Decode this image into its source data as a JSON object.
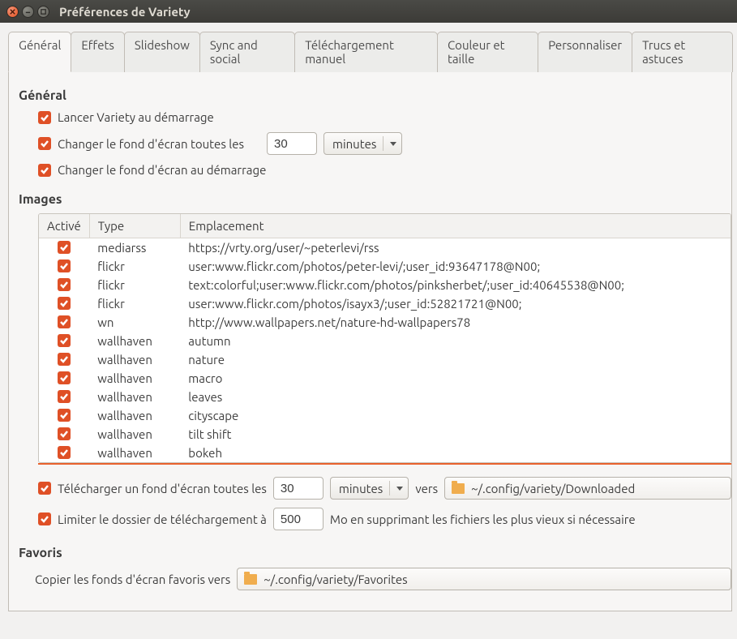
{
  "window": {
    "title": "Préférences de Variety"
  },
  "tabs": [
    {
      "label": "Général"
    },
    {
      "label": "Effets"
    },
    {
      "label": "Slideshow"
    },
    {
      "label": "Sync and social"
    },
    {
      "label": "Téléchargement manuel"
    },
    {
      "label": "Couleur et taille"
    },
    {
      "label": "Personnaliser"
    },
    {
      "label": "Trucs et astuces"
    }
  ],
  "general": {
    "heading": "Général",
    "startup_label": "Lancer Variety au démarrage",
    "change_every_label": "Changer le fond d'écran toutes les",
    "change_every_value": "30",
    "change_every_unit": "minutes",
    "change_on_start_label": "Changer le fond d'écran au démarrage"
  },
  "images": {
    "heading": "Images",
    "columns": {
      "enabled": "Activé",
      "type": "Type",
      "location": "Emplacement"
    },
    "rows": [
      {
        "enabled": true,
        "type": "mediarss",
        "location": "https://vrty.org/user/~peterlevi/rss"
      },
      {
        "enabled": true,
        "type": "flickr",
        "location": "user:www.flickr.com/photos/peter-levi/;user_id:93647178@N00;"
      },
      {
        "enabled": true,
        "type": "flickr",
        "location": "text:colorful;user:www.flickr.com/photos/pinksherbet/;user_id:40645538@N00;"
      },
      {
        "enabled": true,
        "type": "flickr",
        "location": "user:www.flickr.com/photos/isayx3/;user_id:52821721@N00;"
      },
      {
        "enabled": true,
        "type": "wn",
        "location": "http://www.wallpapers.net/nature-hd-wallpapers78"
      },
      {
        "enabled": true,
        "type": "wallhaven",
        "location": "autumn"
      },
      {
        "enabled": true,
        "type": "wallhaven",
        "location": "nature"
      },
      {
        "enabled": true,
        "type": "wallhaven",
        "location": "macro"
      },
      {
        "enabled": true,
        "type": "wallhaven",
        "location": "leaves"
      },
      {
        "enabled": true,
        "type": "wallhaven",
        "location": "cityscape"
      },
      {
        "enabled": true,
        "type": "wallhaven",
        "location": "tilt shift"
      },
      {
        "enabled": true,
        "type": "wallhaven",
        "location": "bokeh"
      }
    ],
    "download_every_label": "Télécharger un fond d'écran toutes les",
    "download_every_value": "30",
    "download_every_unit": "minutes",
    "download_to_word": "vers",
    "download_path": "~/.config/variety/Downloaded",
    "limit_folder_label": "Limiter le dossier de téléchargement à",
    "limit_folder_value": "500",
    "limit_folder_suffix": "Mo en supprimant les fichiers les plus vieux si nécessaire"
  },
  "favorites": {
    "heading": "Favoris",
    "copy_label": "Copier les fonds d'écran favoris vers",
    "path": "~/.config/variety/Favorites"
  }
}
